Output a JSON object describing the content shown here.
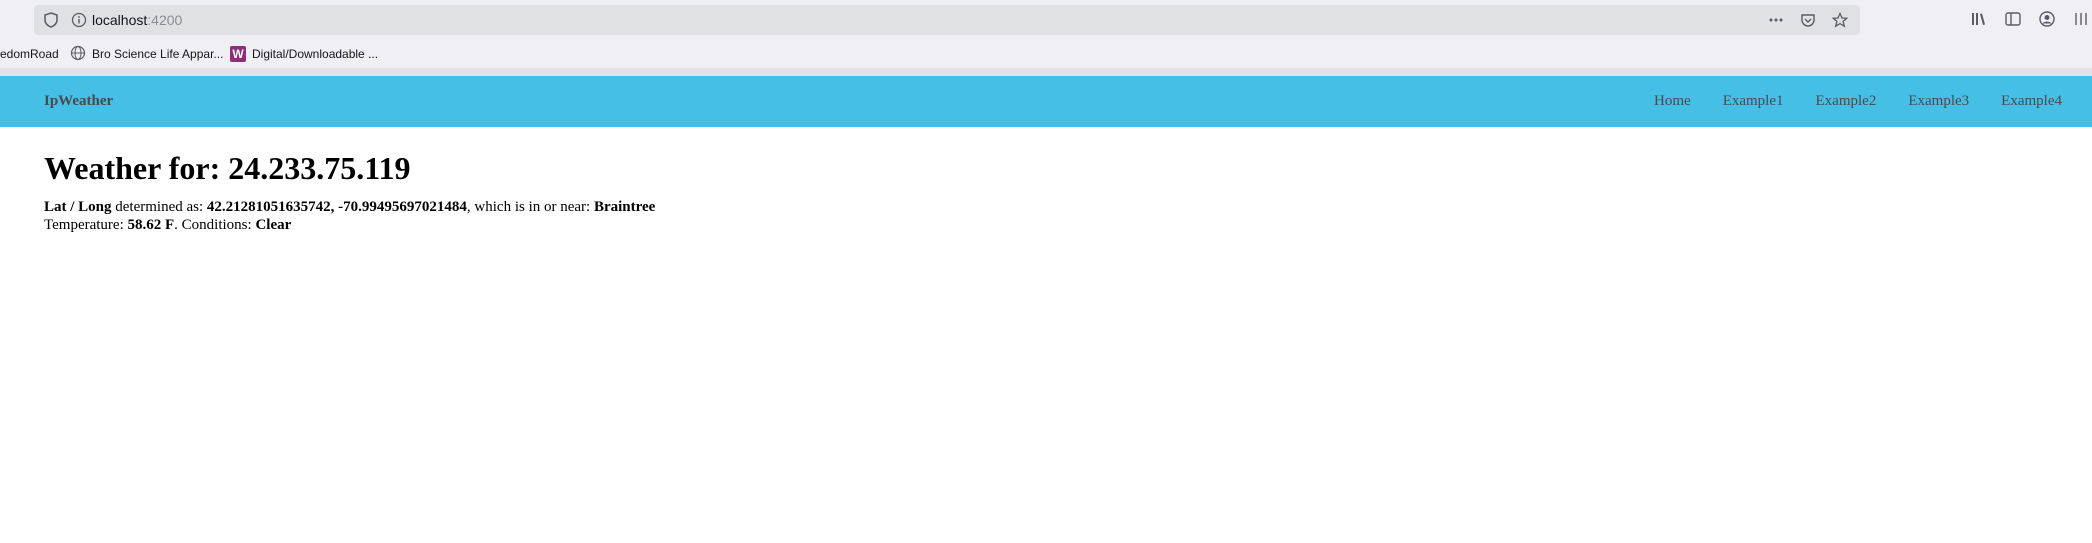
{
  "browser": {
    "url_host": "localhost",
    "url_port": ":4200",
    "bookmarks": [
      {
        "label": "edomRoad"
      },
      {
        "label": "Bro Science Life Appar..."
      },
      {
        "label": "Digital/Downloadable ..."
      }
    ]
  },
  "navbar": {
    "brand": "IpWeather",
    "links": [
      "Home",
      "Example1",
      "Example2",
      "Example3",
      "Example4"
    ]
  },
  "weather": {
    "heading": "Weather for: 24.233.75.119",
    "latlong_label": "Lat / Long",
    "determined_as": " determined as: ",
    "coordinates": "42.21281051635742, -70.99495697021484",
    "near_text": ", which is in or near: ",
    "city": "Braintree",
    "temperature_label": "Temperature: ",
    "temperature": "58.62 F",
    "conditions_label": ". Conditions: ",
    "conditions": "Clear"
  }
}
